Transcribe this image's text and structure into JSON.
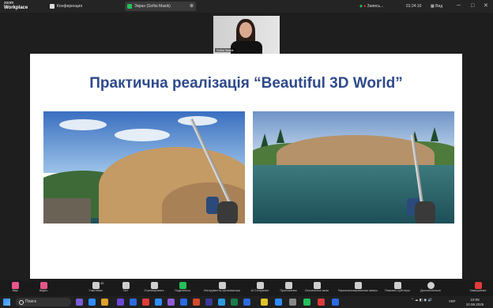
{
  "titlebar": {
    "logo_line1": "zoom",
    "logo_line2": "Workplace",
    "tabs": [
      {
        "label": "Конференция",
        "icon": "video-icon"
      },
      {
        "label": "Экран (Sofiia Masik)",
        "icon": "screen-share-icon",
        "close": "⊗"
      }
    ],
    "recording_label": "Запись...",
    "timer": "01:24:10",
    "view_label": "Вид",
    "window_controls": [
      "─",
      "□",
      "✕"
    ]
  },
  "video": {
    "name": "Sofiia Masik"
  },
  "slide": {
    "title": "Практична реалізація “Beautiful 3D World”",
    "title_color": "#2f4a8a"
  },
  "toolbar": {
    "buttons": [
      {
        "label": "Звук",
        "icon": "mic-muted-icon"
      },
      {
        "label": "Видео",
        "icon": "video-muted-icon"
      },
      {
        "label": "Участники",
        "icon": "participants-icon",
        "count": "35"
      },
      {
        "label": "Чат",
        "icon": "chat-icon"
      },
      {
        "label": "Отреагировать",
        "icon": "heart-icon"
      },
      {
        "label": "Поделиться",
        "icon": "share-icon"
      },
      {
        "label": "Инструменты организатора",
        "icon": "shield-icon"
      },
      {
        "label": "AI Companion",
        "icon": "ai-companion-icon"
      },
      {
        "label": "Приложения",
        "icon": "apps-icon"
      },
      {
        "label": "Сессионные залы",
        "icon": "breakout-rooms-icon"
      },
      {
        "label": "Персонализированная запись",
        "icon": "record-icon"
      },
      {
        "label": "Показать субтитры",
        "icon": "captions-icon"
      },
      {
        "label": "Дополнительно",
        "icon": "more-icon"
      },
      {
        "label": "Завершение",
        "icon": "end-icon"
      }
    ]
  },
  "taskbar": {
    "search_placeholder": "Поиск",
    "lang": "УКР",
    "time": "10:09",
    "date": "10.06.2025"
  }
}
